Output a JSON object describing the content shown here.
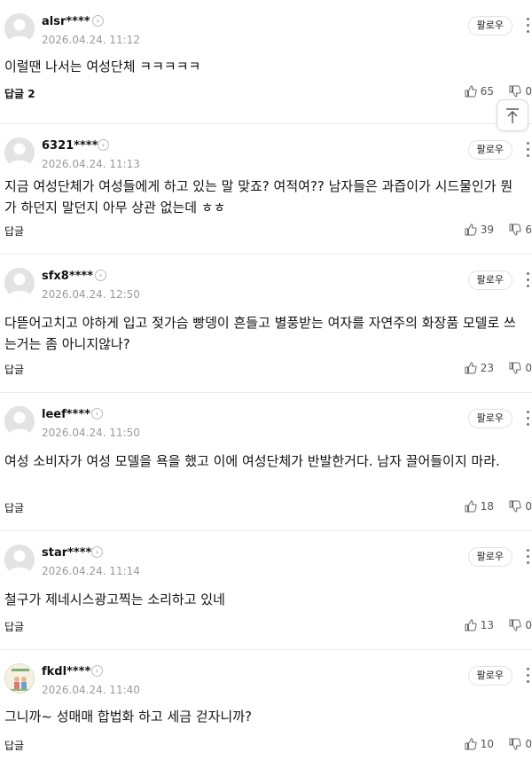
{
  "labels": {
    "follow": "팔로우",
    "reply": "답글",
    "reply_with_count": "답글 2"
  },
  "comments": [
    {
      "username": "alsr****",
      "date": "2026.04.24. 11:12",
      "body": "이럴땐 나서는 여성단체 ㅋㅋㅋㅋㅋ",
      "likes": "65",
      "dislikes": "0",
      "reply_label": "답글 2"
    },
    {
      "username": "6321****",
      "date": "2026.04.24. 11:13",
      "body": "지금 여성단체가 여성들에게 하고 있는 말 맞죠? 여적여?? 남자들은 과즙이가 시드물인가 뭔가 하던지 말던지 아무 상관 없는데 ㅎㅎ",
      "likes": "39",
      "dislikes": "6",
      "reply_label": "답글"
    },
    {
      "username": "sfx8****",
      "date": "2026.04.24. 12:50",
      "body": "다뜯어고치고 야하게 입고 젖가슴 빵뎅이 흔들고 별풍받는 여자를 자연주의 화장품 모델로 쓰는거는 좀 아니지않나?",
      "likes": "23",
      "dislikes": "0",
      "reply_label": "답글"
    },
    {
      "username": "leef****",
      "date": "2026.04.24. 11:50",
      "body": "여성 소비자가 여성 모델을 욕을 했고 이에 여성단체가 반발한거다. 남자 끌어들이지 마라.",
      "likes": "18",
      "dislikes": "0",
      "reply_label": "답글"
    },
    {
      "username": "star****",
      "date": "2026.04.24. 11:14",
      "body": "철구가 제네시스광고찍는 소리하고 있네",
      "likes": "13",
      "dislikes": "0",
      "reply_label": "답글"
    },
    {
      "username": "fkdl****",
      "date": "2026.04.24. 11:40",
      "body": "그니까~ 성매매 합법화 하고 세금 걷자니까?",
      "likes": "10",
      "dislikes": "0",
      "reply_label": "답글"
    }
  ],
  "icons": {
    "avatar_default": "default-avatar-icon",
    "avatar_custom": "book-cover-avatar-icon",
    "like": "thumbs-up-icon",
    "dislike": "thumbs-down-icon",
    "scroll_top": "arrow-up-icon"
  }
}
